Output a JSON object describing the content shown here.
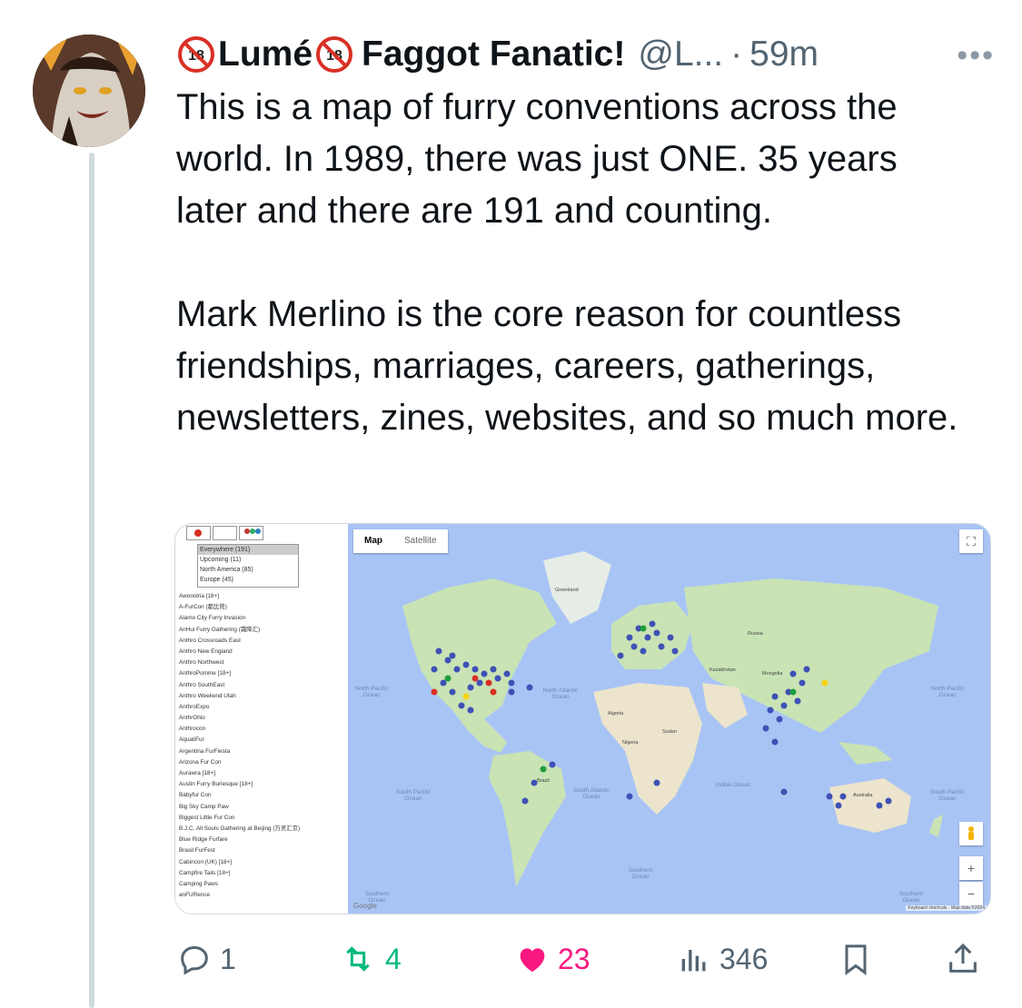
{
  "tweet": {
    "display_name_part1": "Lumé",
    "display_name_part2": "Faggot Fanatic!",
    "handle": "@L...",
    "separator": "·",
    "time": "59m",
    "more_label": "•••",
    "body_paragraph_1": "This is a map of furry conventions across the world. In 1989, there was just ONE. 35 years later and there are 191 and counting.",
    "body_paragraph_2": "Mark Merlino is the core reason for countless friendships, marriages, careers, gatherings, newsletters, zines, websites, and so much more."
  },
  "media": {
    "filter_options": [
      "Everywhere (191)",
      "Upcoming (11)",
      "North America (85)",
      "Europe (45)"
    ],
    "conventions": [
      "Awoostria [18+]",
      "A-FurCon (都比熊)",
      "Alamo City Furry Invasion",
      "AnHui Furry Gathering (霜降汇)",
      "Anthro Crossroads East",
      "Anthro New England",
      "Anthro Northwest",
      "AnthroPomme [18+]",
      "Anthro SouthEast",
      "Anthro Weekend Utah",
      "AnthroExpo",
      "AnthrOhio",
      "Anthrocon",
      "AquatiFur",
      "Argentina FurFiesta",
      "Arizona Fur Con",
      "Aurawra [18+]",
      "Austin Furry Burlesque [18+]",
      "Babyfur Con",
      "Big Sky Camp Paw",
      "Biggest Little Fur Con",
      "B.J.C. All Souls Gathering at Beijing (万灵汇京)",
      "Blue Ridge Furfare",
      "Brasil FurFest",
      "Cabincon (UK) [18+]",
      "Campfire Tails [18+]",
      "Camping Paws",
      "anFURence"
    ],
    "map": {
      "tab_map": "Map",
      "tab_satellite": "Satellite",
      "zoom_in": "+",
      "zoom_out": "−",
      "fullscreen": "⛶",
      "oceans": {
        "north_pacific_left": "North Pacific Ocean",
        "north_atlantic": "North Atlantic Ocean",
        "south_pacific_left": "South Pacific Ocean",
        "south_atlantic": "South Atlantic Ocean",
        "indian": "Indian Ocean",
        "north_pacific_right": "North Pacific Ocean",
        "south_pacific_right": "South Pacific Ocean",
        "southern_left": "Southern Ocean",
        "southern_mid": "Southern Ocean",
        "southern_right": "Southern Ocean"
      },
      "land": {
        "greenland": "Greenland",
        "russia": "Russia",
        "kazakhstan": "Kazakhstan",
        "mongolia": "Mongolia",
        "australia": "Australia",
        "brazil": "Brazil",
        "algeria": "Algeria",
        "sudan": "Sudan",
        "nigeria": "Nigeria"
      },
      "attribution_google": "Google",
      "attribution_right": "Keyboard shortcuts · Map data ©2024"
    }
  },
  "actions": {
    "replies": "1",
    "reposts": "4",
    "likes": "23",
    "views": "346"
  },
  "colors": {
    "like": "#f91880",
    "repost": "#00ba7c",
    "muted": "#536471",
    "land": "#c9e3b5",
    "water": "#a8c4f5",
    "pin_blue": "#3f51b5",
    "pin_red": "#d93025",
    "pin_green": "#1e9e3c",
    "pin_yellow": "#f5d414"
  }
}
